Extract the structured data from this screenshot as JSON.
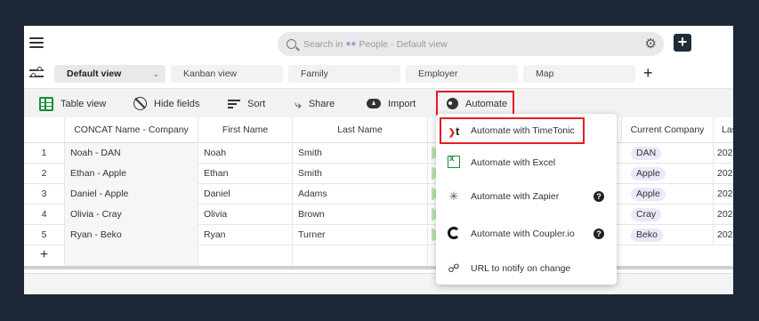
{
  "search": {
    "prefix": "Search in",
    "table_name": "People",
    "suffix": "- Default view"
  },
  "views": [
    {
      "label": "Default view"
    },
    {
      "label": "Kanban view"
    },
    {
      "label": "Family"
    },
    {
      "label": "Employer"
    },
    {
      "label": "Map"
    }
  ],
  "toolbar": {
    "table_view": "Table view",
    "hide_fields": "Hide fields",
    "sort": "Sort",
    "share": "Share",
    "import": "Import",
    "automate": "Automate"
  },
  "table": {
    "columns": [
      "CONCAT Name - Company",
      "First Name",
      "Last Name",
      "Current Company",
      "Las"
    ],
    "rows": [
      {
        "num": "1",
        "concat": "Noah - DAN",
        "first": "Noah",
        "last": "Smith",
        "company": "DAN",
        "las": "202"
      },
      {
        "num": "2",
        "concat": "Ethan - Apple",
        "first": "Ethan",
        "last": "Smith",
        "company": "Apple",
        "las": "202"
      },
      {
        "num": "3",
        "concat": "Daniel - Apple",
        "first": "Daniel",
        "last": "Adams",
        "company": "Apple",
        "las": "202"
      },
      {
        "num": "4",
        "concat": "Olivia - Cray",
        "first": "Olivia",
        "last": "Brown",
        "company": "Cray",
        "las": "202"
      },
      {
        "num": "5",
        "concat": "Ryan - Beko",
        "first": "Ryan",
        "last": "Turner",
        "company": "Beko",
        "las": "202"
      }
    ],
    "add_row": "+"
  },
  "automate_menu": {
    "items": [
      {
        "label": "Automate with TimeTonic",
        "icon": "timetonic-icon"
      },
      {
        "label": "Automate with Excel",
        "icon": "excel-icon"
      },
      {
        "label": "Automate with Zapier",
        "icon": "zapier-icon",
        "help": "?"
      },
      {
        "label": "Automate with Coupler.io",
        "icon": "coupler-icon",
        "help": "?"
      },
      {
        "label": "URL to notify on change",
        "icon": "link-icon"
      }
    ]
  },
  "colors": {
    "background": "#1c2836",
    "highlight": "#e21d24",
    "pill": "#ede7f9",
    "table_view_icon": "#1b8a3e"
  }
}
